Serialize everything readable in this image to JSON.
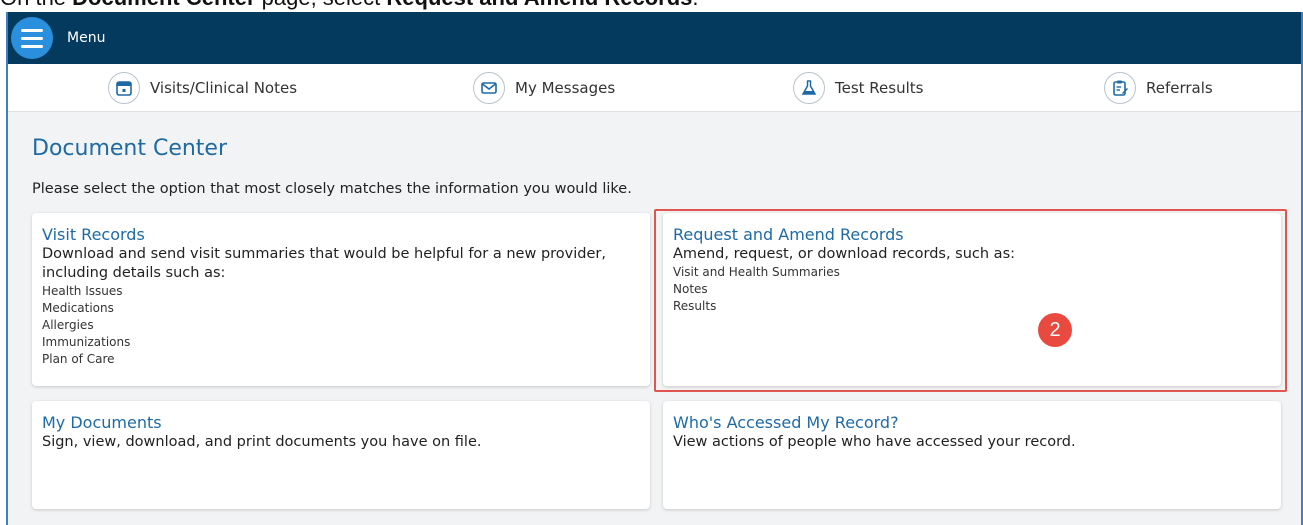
{
  "caption": {
    "prefix": "On the ",
    "bold1": "Document Center",
    "middle": " page, select ",
    "bold2": "Request and Amend Records",
    "suffix": "."
  },
  "header": {
    "menu_label": "Menu"
  },
  "quicknav": [
    {
      "label": "Visits/Clinical Notes",
      "icon": "calendar-icon"
    },
    {
      "label": "My Messages",
      "icon": "envelope-icon"
    },
    {
      "label": "Test Results",
      "icon": "flask-icon"
    },
    {
      "label": "Referrals",
      "icon": "clipboard-icon"
    }
  ],
  "page": {
    "title": "Document Center",
    "instruction": "Please select the option that most closely matches the information you would like."
  },
  "cards": {
    "visit_records": {
      "title": "Visit Records",
      "desc": "Download and send visit summaries that would be helpful for a new provider, including details such as:",
      "items": [
        "Health Issues",
        "Medications",
        "Allergies",
        "Immunizations",
        "Plan of Care"
      ]
    },
    "request_amend": {
      "title": "Request and Amend Records",
      "desc": "Amend, request, or download records, such as:",
      "items": [
        "Visit and Health Summaries",
        "Notes",
        "Results"
      ]
    },
    "my_documents": {
      "title": "My Documents",
      "desc": "Sign, view, download, and print documents you have on file."
    },
    "whos_accessed": {
      "title": "Who's Accessed My Record?",
      "desc": "View actions of people who have accessed your record."
    }
  },
  "annotation": {
    "step_number": "2",
    "color": "#e94a3f"
  },
  "colors": {
    "header_bg": "#053a5f",
    "accent": "#1e6aa5",
    "menu_btn": "#2a8fdc"
  }
}
